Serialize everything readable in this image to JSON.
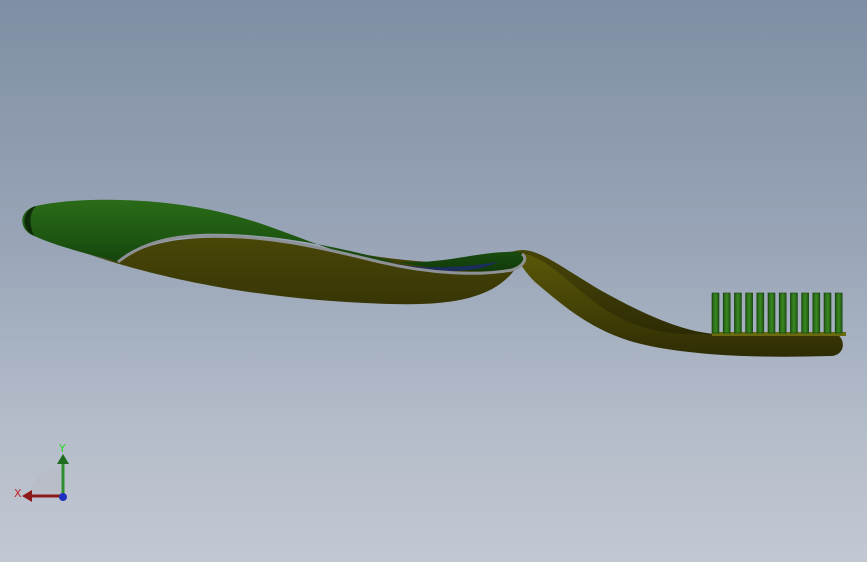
{
  "viewport": {
    "background_top": "#7f8ea4",
    "background_bottom": "#c2c8d2"
  },
  "model": {
    "name": "toothbrush",
    "handle_grip_color": "#1f5a12",
    "handle_body_color": "#3c3a08",
    "neck_color": "#4a4708",
    "bristle_color": "#2d6a1a",
    "trim_color": "#8e9196"
  },
  "triad": {
    "x_label": "X",
    "y_label": "Y",
    "x_color": "#c0242a",
    "y_color": "#2fd42f",
    "z_color": "#2030c0"
  }
}
